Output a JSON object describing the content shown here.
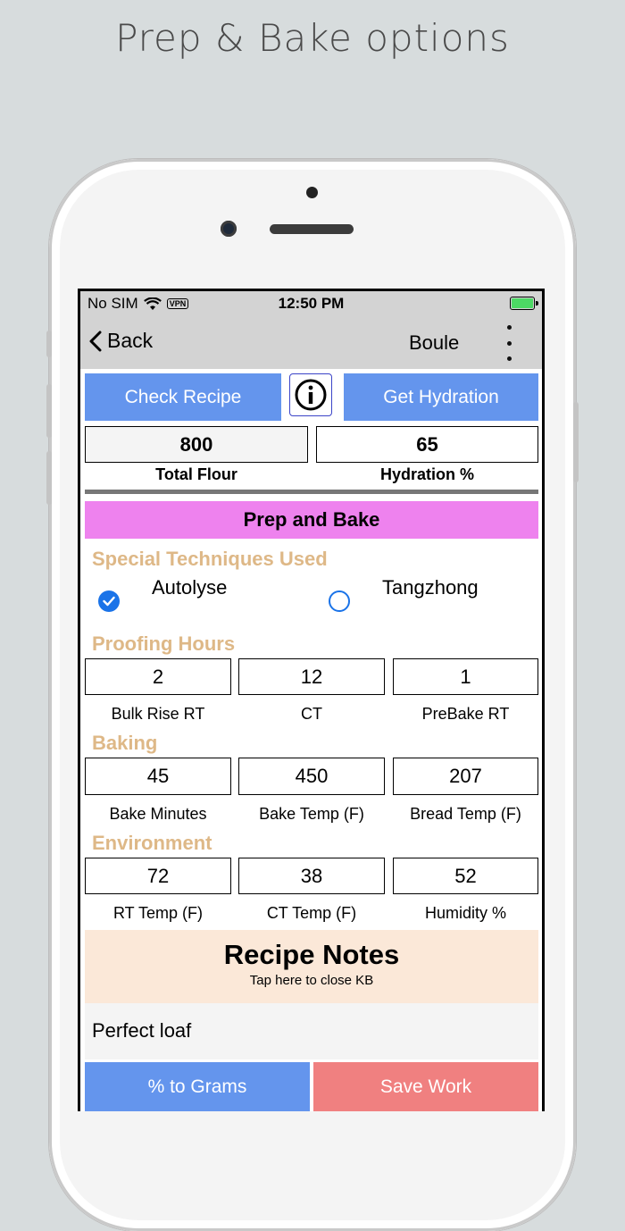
{
  "caption": "Prep & Bake options",
  "status": {
    "carrier": "No SIM",
    "vpn": "VPN",
    "time": "12:50 PM"
  },
  "nav": {
    "back_label": "Back",
    "title": "Boule"
  },
  "buttons": {
    "check_recipe": "Check Recipe",
    "get_hydration": "Get Hydration",
    "to_grams": "% to Grams",
    "save_work": "Save Work"
  },
  "totals": {
    "total_flour_value": "800",
    "total_flour_label": "Total Flour",
    "hydration_value": "65",
    "hydration_label": "Hydration %"
  },
  "section_banner": "Prep and Bake",
  "techniques": {
    "header": "Special Techniques Used",
    "options": [
      {
        "label": "Autolyse",
        "checked": true
      },
      {
        "label": "Tangzhong",
        "checked": false
      }
    ]
  },
  "proofing": {
    "header": "Proofing Hours",
    "fields": [
      {
        "value": "2",
        "label": "Bulk Rise RT"
      },
      {
        "value": "12",
        "label": "CT"
      },
      {
        "value": "1",
        "label": "PreBake RT"
      }
    ]
  },
  "baking": {
    "header": "Baking",
    "fields": [
      {
        "value": "45",
        "label": "Bake Minutes"
      },
      {
        "value": "450",
        "label": "Bake Temp (F)"
      },
      {
        "value": "207",
        "label": "Bread Temp (F)"
      }
    ]
  },
  "environment": {
    "header": "Environment",
    "fields": [
      {
        "value": "72",
        "label": "RT Temp (F)"
      },
      {
        "value": "38",
        "label": "CT Temp (F)"
      },
      {
        "value": "52",
        "label": "Humidity %"
      }
    ]
  },
  "notes": {
    "title": "Recipe Notes",
    "subtitle": "Tap here to close KB",
    "text": "Perfect loaf"
  },
  "colors": {
    "blue_button": "#6495ed",
    "red_button": "#f08080",
    "banner": "#ee82ee",
    "section_header": "#deb887",
    "notes_bg": "#fbe8d8",
    "checkbox": "#1a73e8"
  }
}
